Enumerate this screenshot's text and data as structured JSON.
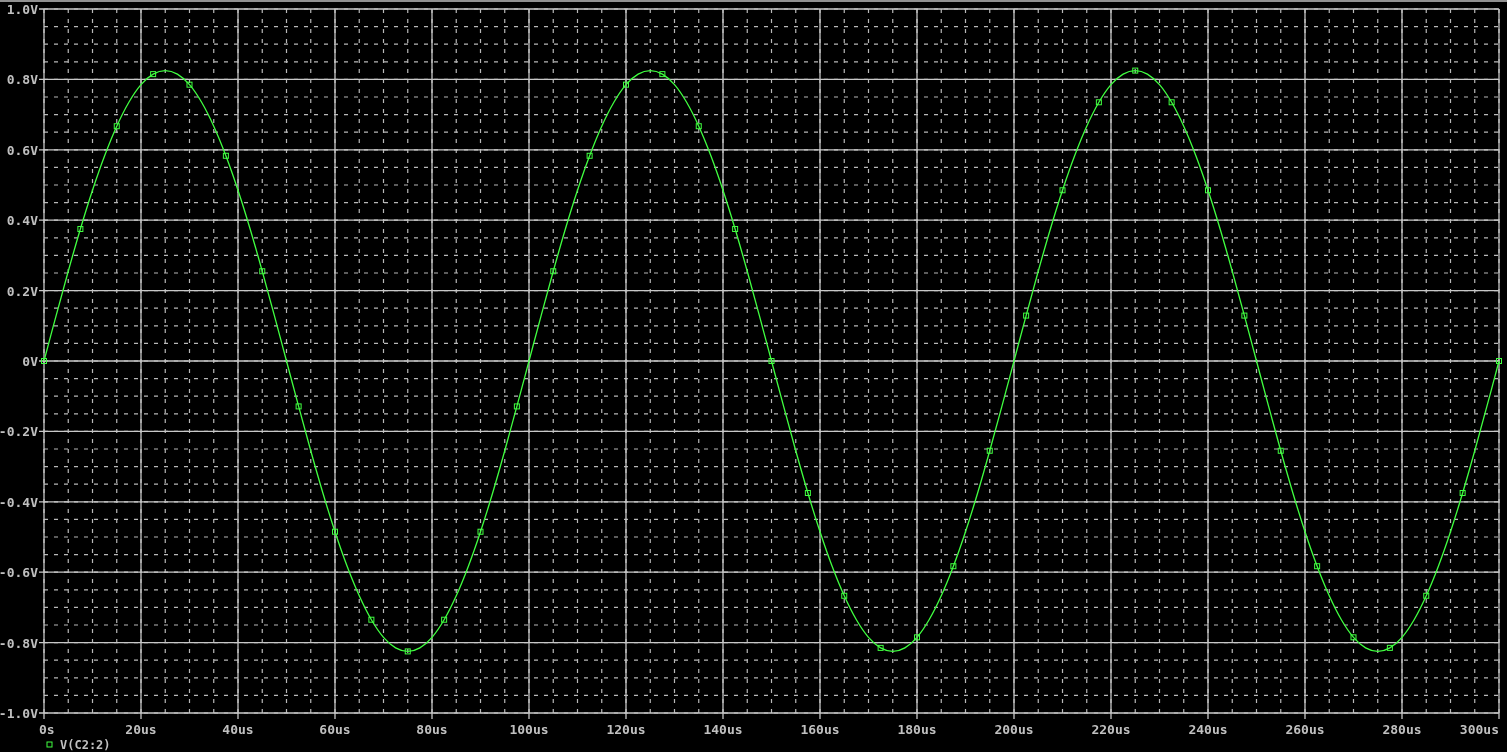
{
  "chart_data": {
    "type": "line",
    "grid": true,
    "xlim": [
      0,
      300
    ],
    "ylim": [
      -1,
      1
    ],
    "xticks": [
      {
        "value": 0,
        "label": "0s"
      },
      {
        "value": 20,
        "label": "20us"
      },
      {
        "value": 40,
        "label": "40us"
      },
      {
        "value": 60,
        "label": "60us"
      },
      {
        "value": 80,
        "label": "80us"
      },
      {
        "value": 100,
        "label": "100us"
      },
      {
        "value": 120,
        "label": "120us"
      },
      {
        "value": 140,
        "label": "140us"
      },
      {
        "value": 160,
        "label": "160us"
      },
      {
        "value": 180,
        "label": "180us"
      },
      {
        "value": 200,
        "label": "200us"
      },
      {
        "value": 220,
        "label": "220us"
      },
      {
        "value": 240,
        "label": "240us"
      },
      {
        "value": 260,
        "label": "260us"
      },
      {
        "value": 280,
        "label": "280us"
      },
      {
        "value": 300,
        "label": "300us"
      }
    ],
    "yticks": [
      {
        "value": 1,
        "label": "1.0V"
      },
      {
        "value": 0.8,
        "label": "0.8V"
      },
      {
        "value": 0.6,
        "label": "0.6V"
      },
      {
        "value": 0.4,
        "label": "0.4V"
      },
      {
        "value": 0.2,
        "label": "0.2V"
      },
      {
        "value": 0,
        "label": "0V"
      },
      {
        "value": -0.2,
        "label": "-0.2V"
      },
      {
        "value": -0.4,
        "label": "-0.4V"
      },
      {
        "value": -0.6,
        "label": "-0.6V"
      },
      {
        "value": -0.8,
        "label": "-0.8V"
      },
      {
        "value": -1,
        "label": "-1.0V"
      }
    ],
    "x": [
      0,
      2.5,
      5,
      7.5,
      10,
      12.5,
      15,
      17.5,
      20,
      22.5,
      25,
      27.5,
      30,
      32.5,
      35,
      37.5,
      40,
      42.5,
      45,
      47.5,
      50,
      52.5,
      55,
      57.5,
      60,
      62.5,
      65,
      67.5,
      70,
      72.5,
      75,
      77.5,
      80,
      82.5,
      85,
      87.5,
      90,
      92.5,
      95,
      97.5,
      100,
      102.5,
      105,
      107.5,
      110,
      112.5,
      115,
      117.5,
      120,
      122.5,
      125,
      127.5,
      130,
      132.5,
      135,
      137.5,
      140,
      142.5,
      145,
      147.5,
      150,
      152.5,
      155,
      157.5,
      160,
      162.5,
      165,
      167.5,
      170,
      172.5,
      175,
      177.5,
      180,
      182.5,
      185,
      187.5,
      190,
      192.5,
      195,
      197.5,
      200,
      202.5,
      205,
      207.5,
      210,
      212.5,
      215,
      217.5,
      220,
      222.5,
      225,
      227.5,
      230,
      232.5,
      235,
      237.5,
      240,
      242.5,
      245,
      247.5,
      250,
      252.5,
      255,
      257.5,
      260,
      262.5,
      265,
      267.5,
      270,
      272.5,
      275,
      277.5,
      280,
      282.5,
      285,
      287.5,
      290,
      292.5,
      295,
      297.5,
      300
    ],
    "series": [
      {
        "name": "V(C2:2)",
        "color": "#40ff40",
        "values": [
          0,
          0.129,
          0.255,
          0.375,
          0.485,
          0.583,
          0.667,
          0.735,
          0.785,
          0.815,
          0.825,
          0.815,
          0.785,
          0.735,
          0.667,
          0.583,
          0.485,
          0.375,
          0.255,
          0.129,
          0,
          -0.129,
          -0.255,
          -0.375,
          -0.485,
          -0.583,
          -0.667,
          -0.735,
          -0.785,
          -0.815,
          -0.825,
          -0.815,
          -0.785,
          -0.735,
          -0.667,
          -0.583,
          -0.485,
          -0.375,
          -0.255,
          -0.129,
          0,
          0.129,
          0.255,
          0.375,
          0.485,
          0.583,
          0.667,
          0.735,
          0.785,
          0.815,
          0.825,
          0.815,
          0.785,
          0.735,
          0.667,
          0.583,
          0.485,
          0.375,
          0.255,
          0.129,
          0,
          -0.129,
          -0.255,
          -0.375,
          -0.485,
          -0.583,
          -0.667,
          -0.735,
          -0.785,
          -0.815,
          -0.825,
          -0.815,
          -0.785,
          -0.735,
          -0.667,
          -0.583,
          -0.485,
          -0.375,
          -0.255,
          -0.129,
          0,
          0.129,
          0.255,
          0.375,
          0.485,
          0.583,
          0.667,
          0.735,
          0.785,
          0.815,
          0.825,
          0.815,
          0.785,
          0.735,
          0.667,
          0.583,
          0.485,
          0.375,
          0.255,
          0.129,
          0,
          -0.129,
          -0.255,
          -0.375,
          -0.485,
          -0.583,
          -0.667,
          -0.735,
          -0.785,
          -0.815,
          -0.825,
          -0.815,
          -0.785,
          -0.735,
          -0.667,
          -0.583,
          -0.485,
          -0.375,
          -0.255,
          -0.129,
          0
        ]
      }
    ]
  }
}
